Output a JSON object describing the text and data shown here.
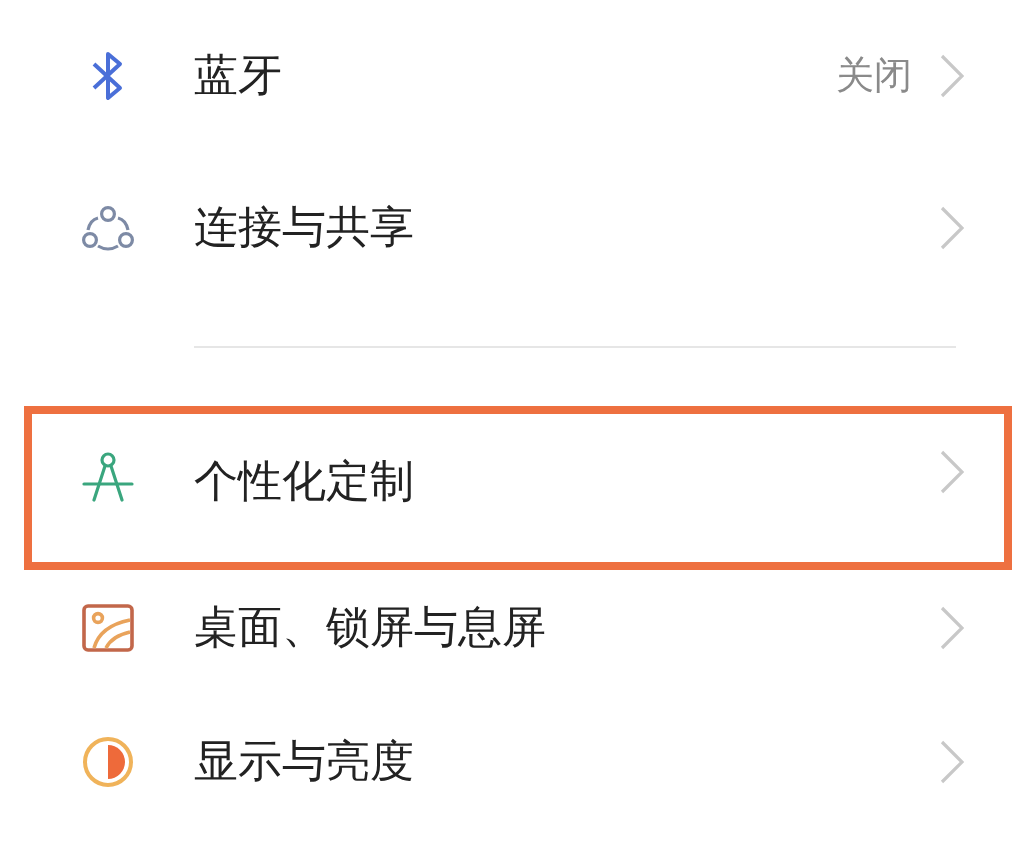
{
  "groups": [
    {
      "items": [
        {
          "kind": "bluetooth",
          "label": "蓝牙",
          "value": "关闭",
          "highlighted": false
        },
        {
          "kind": "sharing",
          "label": "连接与共享",
          "highlighted": false
        }
      ]
    },
    {
      "items": [
        {
          "kind": "personalize",
          "label": "个性化定制",
          "highlighted": true
        },
        {
          "kind": "wallpaper",
          "label": "桌面、锁屏与息屏",
          "highlighted": false
        },
        {
          "kind": "display",
          "label": "显示与亮度",
          "highlighted": false
        }
      ]
    }
  ]
}
